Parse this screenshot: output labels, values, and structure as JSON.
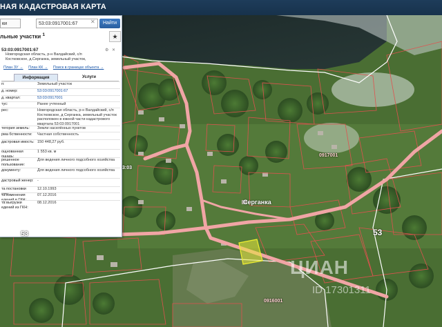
{
  "header": {
    "title": "НАЯ КАДАСТРОВАЯ КАРТА"
  },
  "search": {
    "type_value": "ки",
    "value": "53:03:0917001:67",
    "find_label": "Найти",
    "clear_icon": "close-icon"
  },
  "layer": {
    "title": "льные участки",
    "count": "1"
  },
  "object": {
    "number": "53:03:0917001:67",
    "address_lines": [
      "Новгородская область, р-н Валдайский, с/п",
      "Костковское, д.Серганка, земельный участок,"
    ]
  },
  "links": [
    "План ЗУ →",
    "План КК →",
    "Поиск в границах объекта →"
  ],
  "tabs": [
    "Информация",
    "Услуги"
  ],
  "rows": [
    {
      "k": "п:",
      "v": "Земельный участок",
      "link": false
    },
    {
      "k": "д. номер:",
      "v": "53:03:0917001:67",
      "link": true
    },
    {
      "k": "д. квартал:",
      "v": "53:03:0917001",
      "link": true
    },
    {
      "k": "тус:",
      "v": "Ранее учтенный",
      "link": false
    },
    {
      "k": "рес:",
      "v": "Новгородская область, р-н Валдайский, с/п Костковское, д Серганка, земельный участок расположен в южной части кадастрового квартала 53:03:0917001",
      "link": false
    },
    {
      "k": "тегория земель:",
      "v": "Земли населённых пунктов",
      "link": false
    },
    {
      "k": "рма бственности:",
      "v": "Частная собственность",
      "link": false
    },
    {
      "k": "дастровая имость:",
      "v": "150 448,27 руб.",
      "link": false
    },
    {
      "k": "ощнованная ощадь:",
      "v": "1 553 кв. м",
      "link": false
    },
    {
      "k": "решенное пользование:",
      "v": "Для ведения личного подсобного хозяйства",
      "link": false
    },
    {
      "k": "документу:",
      "v": "Для ведения личного подсобного хозяйства",
      "link": false
    },
    {
      "k": "дастровый женер:",
      "v": "-",
      "link": false
    },
    {
      "k": "та постановки учет:",
      "v": "12.10.1993",
      "link": false
    },
    {
      "k": "та изменения едений в ГКН:",
      "v": "07.12.2016",
      "link": false
    },
    {
      "k": "та выгрузки едений из ГКН:",
      "v": "08.12.2016",
      "link": false
    }
  ],
  "map_labels": {
    "village": "Серганка",
    "road_num_right": "53",
    "road_num_left": "53",
    "quarter_1": "0917001",
    "quarter_2": "0916001",
    "side_code": "3:03"
  },
  "watermark": {
    "main": "ЦИАН",
    "sub": "ID 17301311"
  },
  "colors": {
    "boundary": "#e0524f",
    "road": "#f0a5a5",
    "selected_parcel": "#e8e83a",
    "panel_header": "#1e3c5a"
  }
}
